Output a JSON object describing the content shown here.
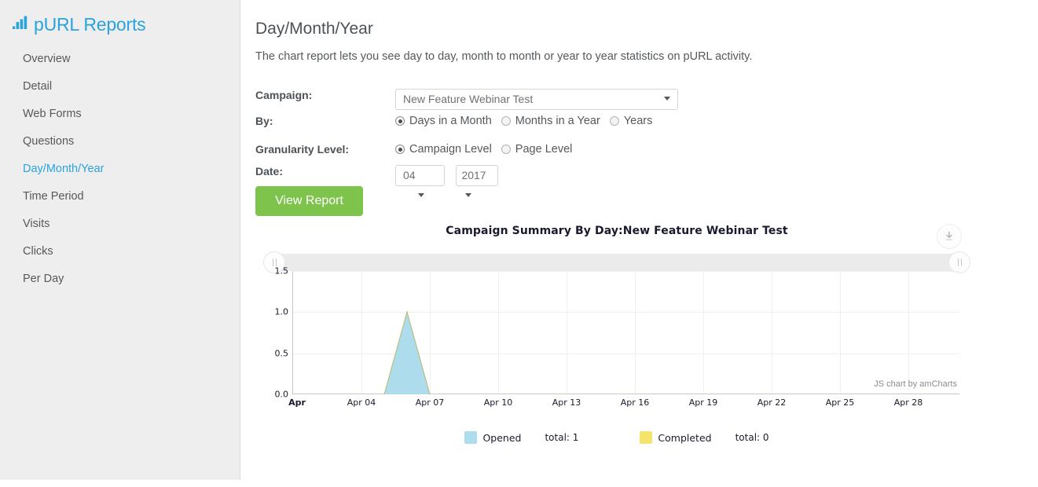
{
  "brand": {
    "title": "pURL Reports",
    "icon": "bar-chart-icon",
    "color": "#29a3dd"
  },
  "sidebar": {
    "items": [
      {
        "label": "Overview",
        "active": false
      },
      {
        "label": "Detail",
        "active": false
      },
      {
        "label": "Web Forms",
        "active": false
      },
      {
        "label": "Questions",
        "active": false
      },
      {
        "label": "Day/Month/Year",
        "active": true
      },
      {
        "label": "Time Period",
        "active": false
      },
      {
        "label": "Visits",
        "active": false
      },
      {
        "label": "Clicks",
        "active": false
      },
      {
        "label": "Per Day",
        "active": false
      }
    ]
  },
  "main": {
    "title": "Day/Month/Year",
    "description": "The chart report lets you see day to day, month to month or year to year statistics on pURL activity."
  },
  "form": {
    "campaign": {
      "label": "Campaign:",
      "value": "New Feature Webinar Test"
    },
    "by": {
      "label": "By:",
      "options": [
        {
          "label": "Days in a Month",
          "checked": true
        },
        {
          "label": "Months in a Year",
          "checked": false
        },
        {
          "label": "Years",
          "checked": false
        }
      ]
    },
    "granularity": {
      "label": "Granularity Level:",
      "options": [
        {
          "label": "Campaign Level",
          "checked": true
        },
        {
          "label": "Page Level",
          "checked": false
        }
      ]
    },
    "date": {
      "label": "Date:",
      "month": "04",
      "year": "2017"
    },
    "submit_label": "View Report",
    "submit_color": "#7ec34c"
  },
  "chart_data": {
    "type": "area",
    "title": "Campaign Summary By Day:New Feature Webinar Test",
    "xlabel": "",
    "ylabel": "",
    "ylim": [
      0,
      1.5
    ],
    "yticks": [
      0.0,
      0.5,
      1.0,
      1.5
    ],
    "ytick_labels": [
      "0.0",
      "0.5",
      "1.0",
      "1.5"
    ],
    "xtick_labels": [
      "Apr",
      "Apr 04",
      "Apr 07",
      "Apr 10",
      "Apr 13",
      "Apr 16",
      "Apr 19",
      "Apr 22",
      "Apr 25",
      "Apr 28"
    ],
    "x": [
      "Apr 01",
      "Apr 02",
      "Apr 03",
      "Apr 04",
      "Apr 05",
      "Apr 06",
      "Apr 07",
      "Apr 08",
      "Apr 09",
      "Apr 10",
      "Apr 11",
      "Apr 12",
      "Apr 13",
      "Apr 14",
      "Apr 15",
      "Apr 16",
      "Apr 17",
      "Apr 18",
      "Apr 19",
      "Apr 20",
      "Apr 21",
      "Apr 22",
      "Apr 23",
      "Apr 24",
      "Apr 25",
      "Apr 26",
      "Apr 27",
      "Apr 28",
      "Apr 29",
      "Apr 30"
    ],
    "grid": true,
    "legend_position": "bottom",
    "series": [
      {
        "name": "Opened",
        "total_label": "total: 1",
        "total": 1,
        "color": "#addced",
        "values": [
          0,
          0,
          0,
          0,
          0,
          1,
          0,
          0,
          0,
          0,
          0,
          0,
          0,
          0,
          0,
          0,
          0,
          0,
          0,
          0,
          0,
          0,
          0,
          0,
          0,
          0,
          0,
          0,
          0,
          0
        ]
      },
      {
        "name": "Completed",
        "total_label": "total: 0",
        "total": 0,
        "color": "#f6e36c",
        "values": [
          0,
          0,
          0,
          0,
          0,
          0,
          0,
          0,
          0,
          0,
          0,
          0,
          0,
          0,
          0,
          0,
          0,
          0,
          0,
          0,
          0,
          0,
          0,
          0,
          0,
          0,
          0,
          0,
          0,
          0
        ]
      }
    ],
    "credit": "JS chart by amCharts"
  },
  "chart_controls": {
    "export_icon": "download-icon",
    "scrollbar_left_grip": "scrollbar-grip-left",
    "scrollbar_right_grip": "scrollbar-grip-right"
  }
}
